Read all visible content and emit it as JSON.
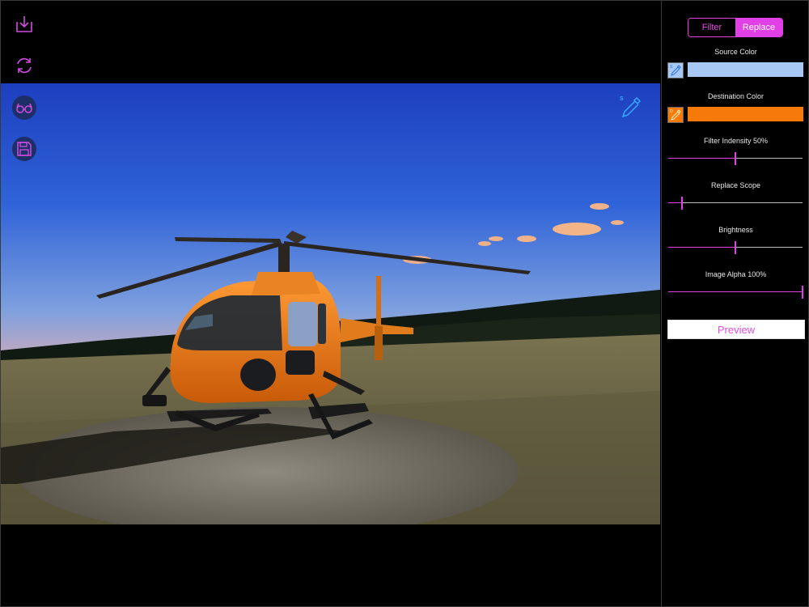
{
  "toolbar": {
    "icons": [
      "download-icon",
      "refresh-icon",
      "glasses-icon",
      "save-icon"
    ]
  },
  "overlay": {
    "picker_badge": "S"
  },
  "panel": {
    "segments": [
      {
        "label": "Filter",
        "selected": false
      },
      {
        "label": "Replace",
        "selected": true
      }
    ],
    "source_color_label": "Source Color",
    "source_color": "#a8c8f4",
    "source_picker_badge": "S",
    "destination_color_label": "Destination Color",
    "destination_color": "#f57a0a",
    "destination_picker_badge": "D",
    "filter_intensity_label": "Filter Indensity 50%",
    "filter_intensity": 0.5,
    "replace_scope_label": "Replace Scope",
    "replace_scope": 0.1,
    "brightness_label": "Brightness",
    "brightness": 0.5,
    "image_alpha_label": "Image Alpha 100%",
    "image_alpha": 1.0,
    "preview_label": "Preview"
  },
  "colors": {
    "accent": "#e040e6",
    "tool_icon": "#d04ce0",
    "round_button_bg": "#1e2e66",
    "picker_blue": "#3aa8ff"
  }
}
